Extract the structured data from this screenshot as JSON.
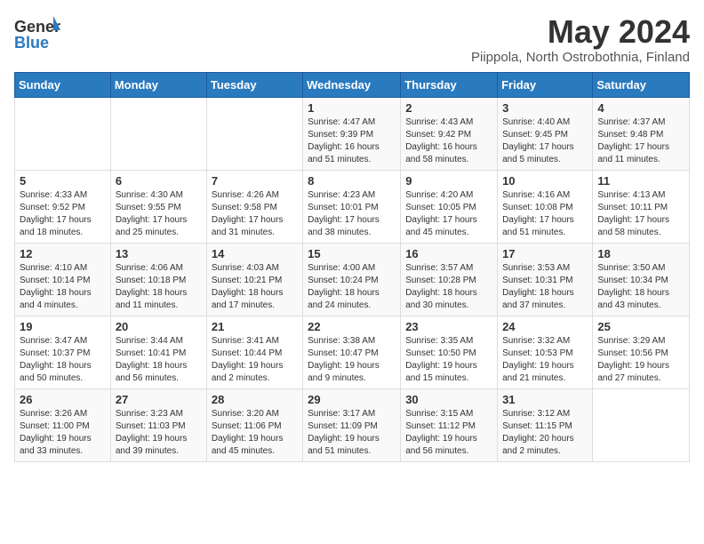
{
  "header": {
    "logo_general": "General",
    "logo_blue": "Blue",
    "month_year": "May 2024",
    "location": "Piippola, North Ostrobothnia, Finland"
  },
  "weekdays": [
    "Sunday",
    "Monday",
    "Tuesday",
    "Wednesday",
    "Thursday",
    "Friday",
    "Saturday"
  ],
  "weeks": [
    [
      {
        "day": "",
        "info": ""
      },
      {
        "day": "",
        "info": ""
      },
      {
        "day": "",
        "info": ""
      },
      {
        "day": "1",
        "info": "Sunrise: 4:47 AM\nSunset: 9:39 PM\nDaylight: 16 hours and 51 minutes."
      },
      {
        "day": "2",
        "info": "Sunrise: 4:43 AM\nSunset: 9:42 PM\nDaylight: 16 hours and 58 minutes."
      },
      {
        "day": "3",
        "info": "Sunrise: 4:40 AM\nSunset: 9:45 PM\nDaylight: 17 hours and 5 minutes."
      },
      {
        "day": "4",
        "info": "Sunrise: 4:37 AM\nSunset: 9:48 PM\nDaylight: 17 hours and 11 minutes."
      }
    ],
    [
      {
        "day": "5",
        "info": "Sunrise: 4:33 AM\nSunset: 9:52 PM\nDaylight: 17 hours and 18 minutes."
      },
      {
        "day": "6",
        "info": "Sunrise: 4:30 AM\nSunset: 9:55 PM\nDaylight: 17 hours and 25 minutes."
      },
      {
        "day": "7",
        "info": "Sunrise: 4:26 AM\nSunset: 9:58 PM\nDaylight: 17 hours and 31 minutes."
      },
      {
        "day": "8",
        "info": "Sunrise: 4:23 AM\nSunset: 10:01 PM\nDaylight: 17 hours and 38 minutes."
      },
      {
        "day": "9",
        "info": "Sunrise: 4:20 AM\nSunset: 10:05 PM\nDaylight: 17 hours and 45 minutes."
      },
      {
        "day": "10",
        "info": "Sunrise: 4:16 AM\nSunset: 10:08 PM\nDaylight: 17 hours and 51 minutes."
      },
      {
        "day": "11",
        "info": "Sunrise: 4:13 AM\nSunset: 10:11 PM\nDaylight: 17 hours and 58 minutes."
      }
    ],
    [
      {
        "day": "12",
        "info": "Sunrise: 4:10 AM\nSunset: 10:14 PM\nDaylight: 18 hours and 4 minutes."
      },
      {
        "day": "13",
        "info": "Sunrise: 4:06 AM\nSunset: 10:18 PM\nDaylight: 18 hours and 11 minutes."
      },
      {
        "day": "14",
        "info": "Sunrise: 4:03 AM\nSunset: 10:21 PM\nDaylight: 18 hours and 17 minutes."
      },
      {
        "day": "15",
        "info": "Sunrise: 4:00 AM\nSunset: 10:24 PM\nDaylight: 18 hours and 24 minutes."
      },
      {
        "day": "16",
        "info": "Sunrise: 3:57 AM\nSunset: 10:28 PM\nDaylight: 18 hours and 30 minutes."
      },
      {
        "day": "17",
        "info": "Sunrise: 3:53 AM\nSunset: 10:31 PM\nDaylight: 18 hours and 37 minutes."
      },
      {
        "day": "18",
        "info": "Sunrise: 3:50 AM\nSunset: 10:34 PM\nDaylight: 18 hours and 43 minutes."
      }
    ],
    [
      {
        "day": "19",
        "info": "Sunrise: 3:47 AM\nSunset: 10:37 PM\nDaylight: 18 hours and 50 minutes."
      },
      {
        "day": "20",
        "info": "Sunrise: 3:44 AM\nSunset: 10:41 PM\nDaylight: 18 hours and 56 minutes."
      },
      {
        "day": "21",
        "info": "Sunrise: 3:41 AM\nSunset: 10:44 PM\nDaylight: 19 hours and 2 minutes."
      },
      {
        "day": "22",
        "info": "Sunrise: 3:38 AM\nSunset: 10:47 PM\nDaylight: 19 hours and 9 minutes."
      },
      {
        "day": "23",
        "info": "Sunrise: 3:35 AM\nSunset: 10:50 PM\nDaylight: 19 hours and 15 minutes."
      },
      {
        "day": "24",
        "info": "Sunrise: 3:32 AM\nSunset: 10:53 PM\nDaylight: 19 hours and 21 minutes."
      },
      {
        "day": "25",
        "info": "Sunrise: 3:29 AM\nSunset: 10:56 PM\nDaylight: 19 hours and 27 minutes."
      }
    ],
    [
      {
        "day": "26",
        "info": "Sunrise: 3:26 AM\nSunset: 11:00 PM\nDaylight: 19 hours and 33 minutes."
      },
      {
        "day": "27",
        "info": "Sunrise: 3:23 AM\nSunset: 11:03 PM\nDaylight: 19 hours and 39 minutes."
      },
      {
        "day": "28",
        "info": "Sunrise: 3:20 AM\nSunset: 11:06 PM\nDaylight: 19 hours and 45 minutes."
      },
      {
        "day": "29",
        "info": "Sunrise: 3:17 AM\nSunset: 11:09 PM\nDaylight: 19 hours and 51 minutes."
      },
      {
        "day": "30",
        "info": "Sunrise: 3:15 AM\nSunset: 11:12 PM\nDaylight: 19 hours and 56 minutes."
      },
      {
        "day": "31",
        "info": "Sunrise: 3:12 AM\nSunset: 11:15 PM\nDaylight: 20 hours and 2 minutes."
      },
      {
        "day": "",
        "info": ""
      }
    ]
  ]
}
